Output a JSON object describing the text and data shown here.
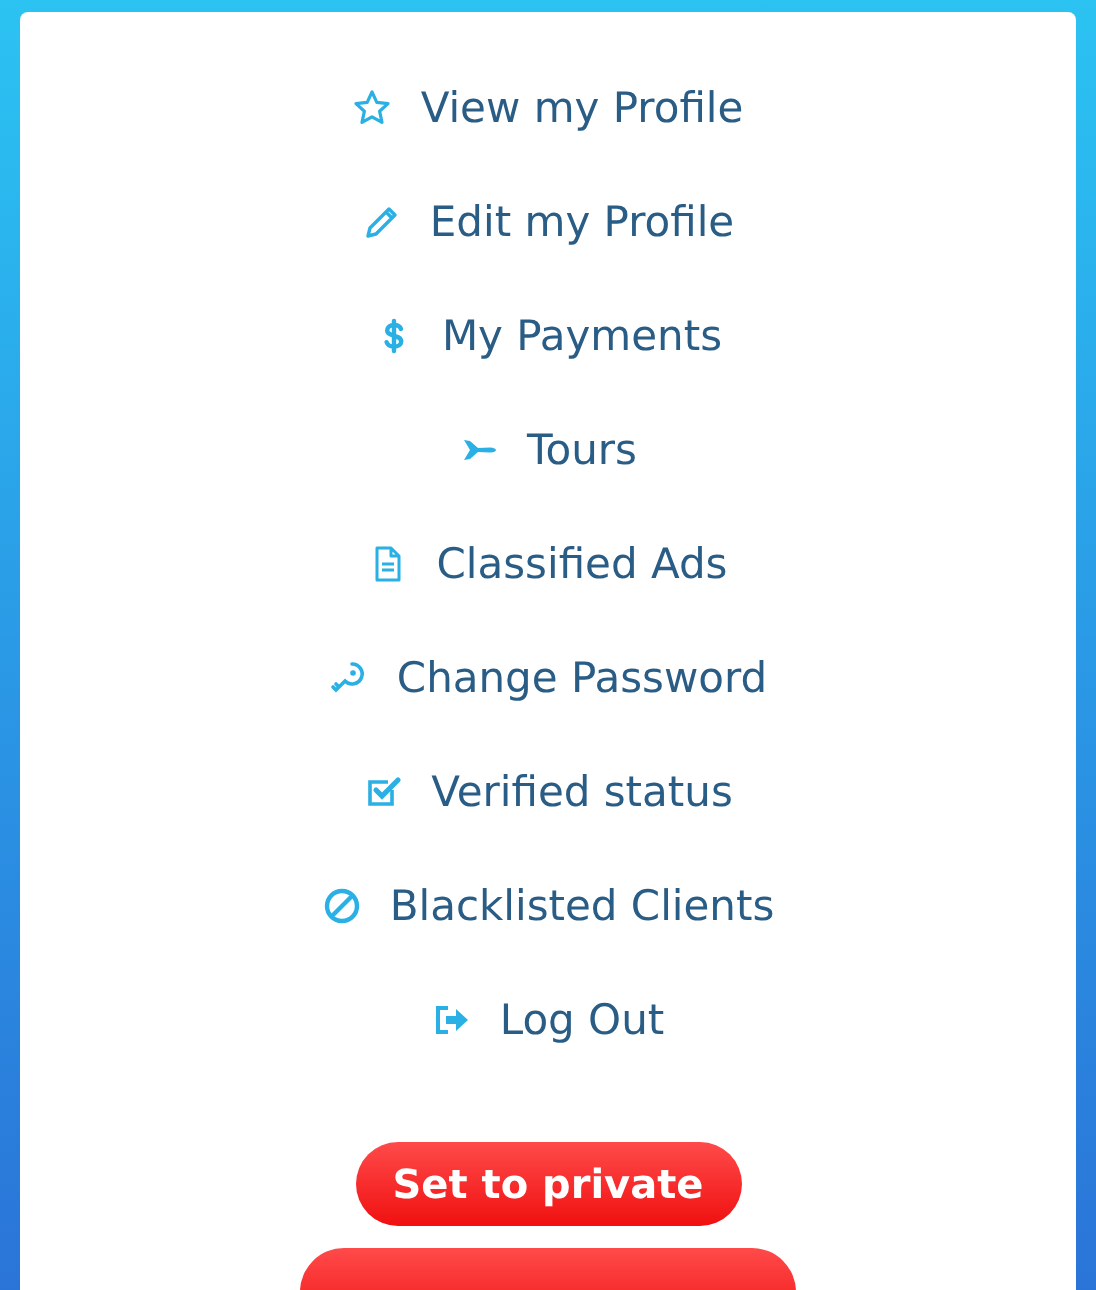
{
  "menu": [
    {
      "label": "View my Profile"
    },
    {
      "label": "Edit my Profile"
    },
    {
      "label": "My Payments"
    },
    {
      "label": "Tours"
    },
    {
      "label": "Classified Ads"
    },
    {
      "label": "Change Password"
    },
    {
      "label": "Verified status"
    },
    {
      "label": "Blacklisted Clients"
    },
    {
      "label": "Log Out"
    }
  ],
  "buttons": [
    {
      "kind": "pill",
      "label": "Set to private"
    },
    {
      "kind": "wide"
    }
  ]
}
